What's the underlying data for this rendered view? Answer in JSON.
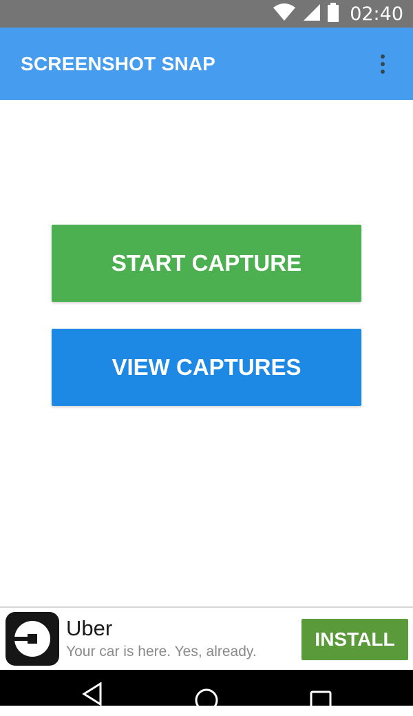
{
  "status_bar": {
    "time": "02:40",
    "icons": [
      "wifi-icon",
      "cell-signal-icon",
      "battery-icon"
    ]
  },
  "app_bar": {
    "title": "SCREENSHOT SNAP",
    "overflow_icon": "more-vert-icon"
  },
  "main": {
    "start_capture_label": "START CAPTURE",
    "view_captures_label": "VIEW CAPTURES"
  },
  "ad": {
    "app_name": "Uber",
    "tagline": "Your car is here. Yes, already.",
    "install_label": "INSTALL",
    "logo_icon": "uber-logo-icon"
  },
  "nav_bar": {
    "icons": [
      "back-icon",
      "home-icon",
      "recents-icon"
    ]
  },
  "colors": {
    "status_bar": "#757575",
    "app_bar": "#469cef",
    "start_button": "#4caf50",
    "view_button": "#1e88e5",
    "install_button": "#5b9a3b",
    "nav_bar": "#000000"
  }
}
